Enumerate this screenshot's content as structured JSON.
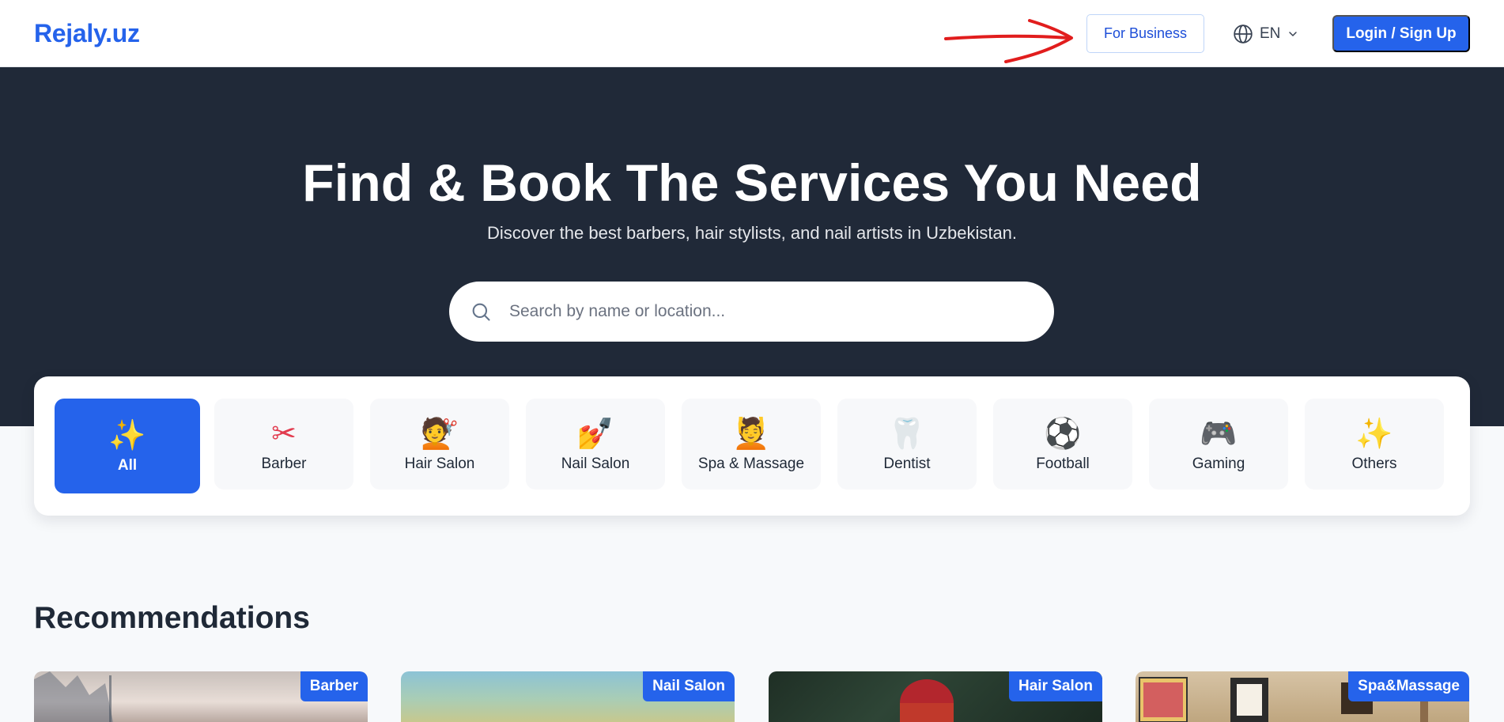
{
  "header": {
    "logo": "Rejaly.uz",
    "for_business": "For Business",
    "language": "EN",
    "login": "Login / Sign Up"
  },
  "hero": {
    "title": "Find & Book The Services You Need",
    "subtitle": "Discover the best barbers, hair stylists, and nail artists in Uzbekistan.",
    "search_placeholder": "Search by name or location..."
  },
  "categories": [
    {
      "label": "All",
      "icon": "sparkles-icon",
      "glyph": "✨",
      "active": true
    },
    {
      "label": "Barber",
      "icon": "scissors-icon",
      "glyph": "✂",
      "active": false
    },
    {
      "label": "Hair Salon",
      "icon": "haircut-icon",
      "glyph": "💇",
      "active": false
    },
    {
      "label": "Nail Salon",
      "icon": "nail-polish-icon",
      "glyph": "💅",
      "active": false
    },
    {
      "label": "Spa & Massage",
      "icon": "massage-icon",
      "glyph": "💆",
      "active": false
    },
    {
      "label": "Dentist",
      "icon": "tooth-icon",
      "glyph": "🦷",
      "active": false
    },
    {
      "label": "Football",
      "icon": "soccer-ball-icon",
      "glyph": "⚽",
      "active": false
    },
    {
      "label": "Gaming",
      "icon": "game-controller-icon",
      "glyph": "🎮",
      "active": false
    },
    {
      "label": "Others",
      "icon": "sparkles-icon",
      "glyph": "✨",
      "active": false
    }
  ],
  "recommendations": {
    "title": "Recommendations",
    "cards": [
      {
        "badge": "Barber"
      },
      {
        "badge": "Nail Salon"
      },
      {
        "badge": "Hair Salon"
      },
      {
        "badge": "Spa&Massage"
      }
    ]
  },
  "colors": {
    "brand": "#2563eb",
    "hero_bg": "#202938",
    "annotation_arrow": "#e11d1d"
  }
}
